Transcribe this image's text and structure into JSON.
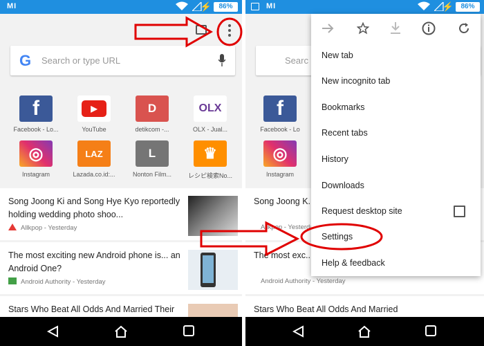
{
  "status": {
    "carrier": "MI",
    "battery": "86%"
  },
  "left": {
    "search_placeholder": "Search or type URL",
    "google_letter": "G",
    "tiles": [
      {
        "label": "Facebook - Lo...",
        "glyph": "f",
        "color": "#3b5998"
      },
      {
        "label": "YouTube",
        "glyph": "▶",
        "color": "#ffffff"
      },
      {
        "label": "detikcom -...",
        "glyph": "D",
        "color": "#d9534f"
      },
      {
        "label": "OLX - Jual...",
        "glyph": "OLX",
        "color": "#ffffff"
      },
      {
        "label": "Instagram",
        "glyph": "◎",
        "color": "#c13584"
      },
      {
        "label": "Lazada.co.id:...",
        "glyph": "LAZ",
        "color": "#f57f17"
      },
      {
        "label": "Nonton Film...",
        "glyph": "L",
        "color": "#757575"
      },
      {
        "label": "レシピ検索No...",
        "glyph": "♛",
        "color": "#ff8f00"
      }
    ],
    "news": [
      {
        "title": "Song Joong Ki and Song Hye Kyo reportedly holding wedding photo shoo...",
        "source": "Allkpop - Yesterday",
        "source_color": "#e53935"
      },
      {
        "title": "The most exciting new Android phone is... an Android One?",
        "source": "Android Authority - Yesterday",
        "source_color": "#43a047"
      },
      {
        "title": "Stars Who Beat All Odds And Married Their First L...",
        "source": "",
        "source_color": "#999999"
      }
    ]
  },
  "right": {
    "search_placeholder_partial": "Searc",
    "tiles": [
      {
        "label": "Facebook - Lo",
        "glyph": "f",
        "color": "#3b5998"
      },
      {
        "label": "Instagram",
        "glyph": "◎",
        "color": "#c13584"
      }
    ],
    "news": [
      {
        "title": "Song Joong K...",
        "source": "Allkpop - Yesterday"
      },
      {
        "title": "The most exc... is... an Android One?",
        "source": "Android Authority - Yesterday"
      },
      {
        "title": "Stars Who Beat All Odds And Married"
      }
    ],
    "menu": {
      "icons": [
        "forward-icon",
        "star-icon",
        "download-icon",
        "info-icon",
        "refresh-icon"
      ],
      "items": [
        {
          "label": "New tab"
        },
        {
          "label": "New incognito tab"
        },
        {
          "label": "Bookmarks"
        },
        {
          "label": "Recent tabs"
        },
        {
          "label": "History"
        },
        {
          "label": "Downloads"
        },
        {
          "label": "Request desktop site"
        },
        {
          "label": "Settings"
        },
        {
          "label": "Help & feedback"
        }
      ]
    }
  },
  "colors": {
    "status_bar": "#1f8fe0",
    "annotation": "#e00000"
  }
}
